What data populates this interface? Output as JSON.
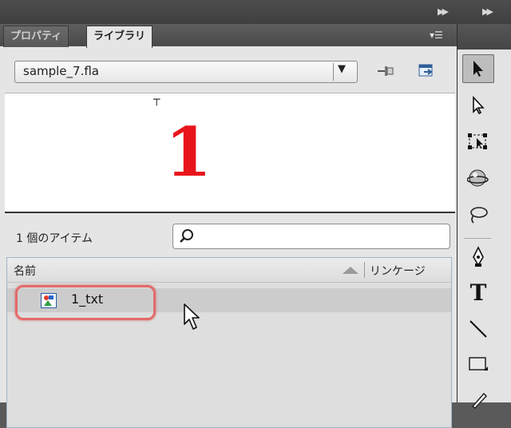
{
  "panel": {
    "tabs": [
      {
        "label": "プロパティ",
        "active": false
      },
      {
        "label": "ライブラリ",
        "active": true
      }
    ],
    "document_select": {
      "value": "sample_7.fla"
    },
    "preview": {
      "symbol_text": "1",
      "symbol_color": "#e8141b"
    },
    "item_count_label": "1 個のアイテム",
    "search": {
      "value": ""
    },
    "list": {
      "columns": [
        "名前",
        "リンケージ"
      ],
      "items": [
        {
          "name": "1_txt",
          "icon": "graphic-symbol-icon",
          "selected": true
        }
      ]
    }
  },
  "tools": [
    "selection-tool-icon",
    "subselection-tool-icon",
    "free-transform-tool-icon",
    "3d-rotation-tool-icon",
    "lasso-tool-icon",
    "pen-tool-icon",
    "text-tool-icon",
    "line-tool-icon",
    "rectangle-tool-icon",
    "pencil-tool-icon"
  ],
  "colors": {
    "highlight": "#e46a6a",
    "accent_red": "#e8141b"
  }
}
